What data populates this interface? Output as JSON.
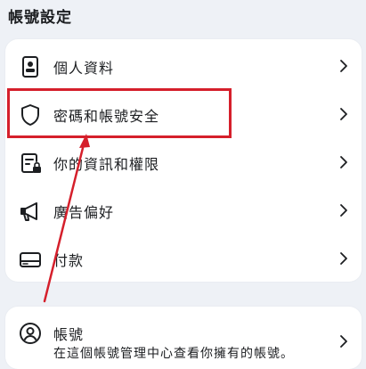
{
  "section": {
    "title": "帳號設定"
  },
  "menu": {
    "items": [
      {
        "label": "個人資料",
        "icon": "id-card-icon"
      },
      {
        "label": "密碼和帳號安全",
        "icon": "shield-icon"
      },
      {
        "label": "你的資訊和權限",
        "icon": "document-lock-icon"
      },
      {
        "label": "廣告偏好",
        "icon": "megaphone-icon"
      },
      {
        "label": "付款",
        "icon": "credit-card-icon"
      }
    ]
  },
  "account": {
    "label": "帳號",
    "description": "在這個帳號管理中心查看你擁有的帳號。",
    "icon": "user-circle-icon"
  },
  "annotation": {
    "color": "#d51f2b"
  }
}
